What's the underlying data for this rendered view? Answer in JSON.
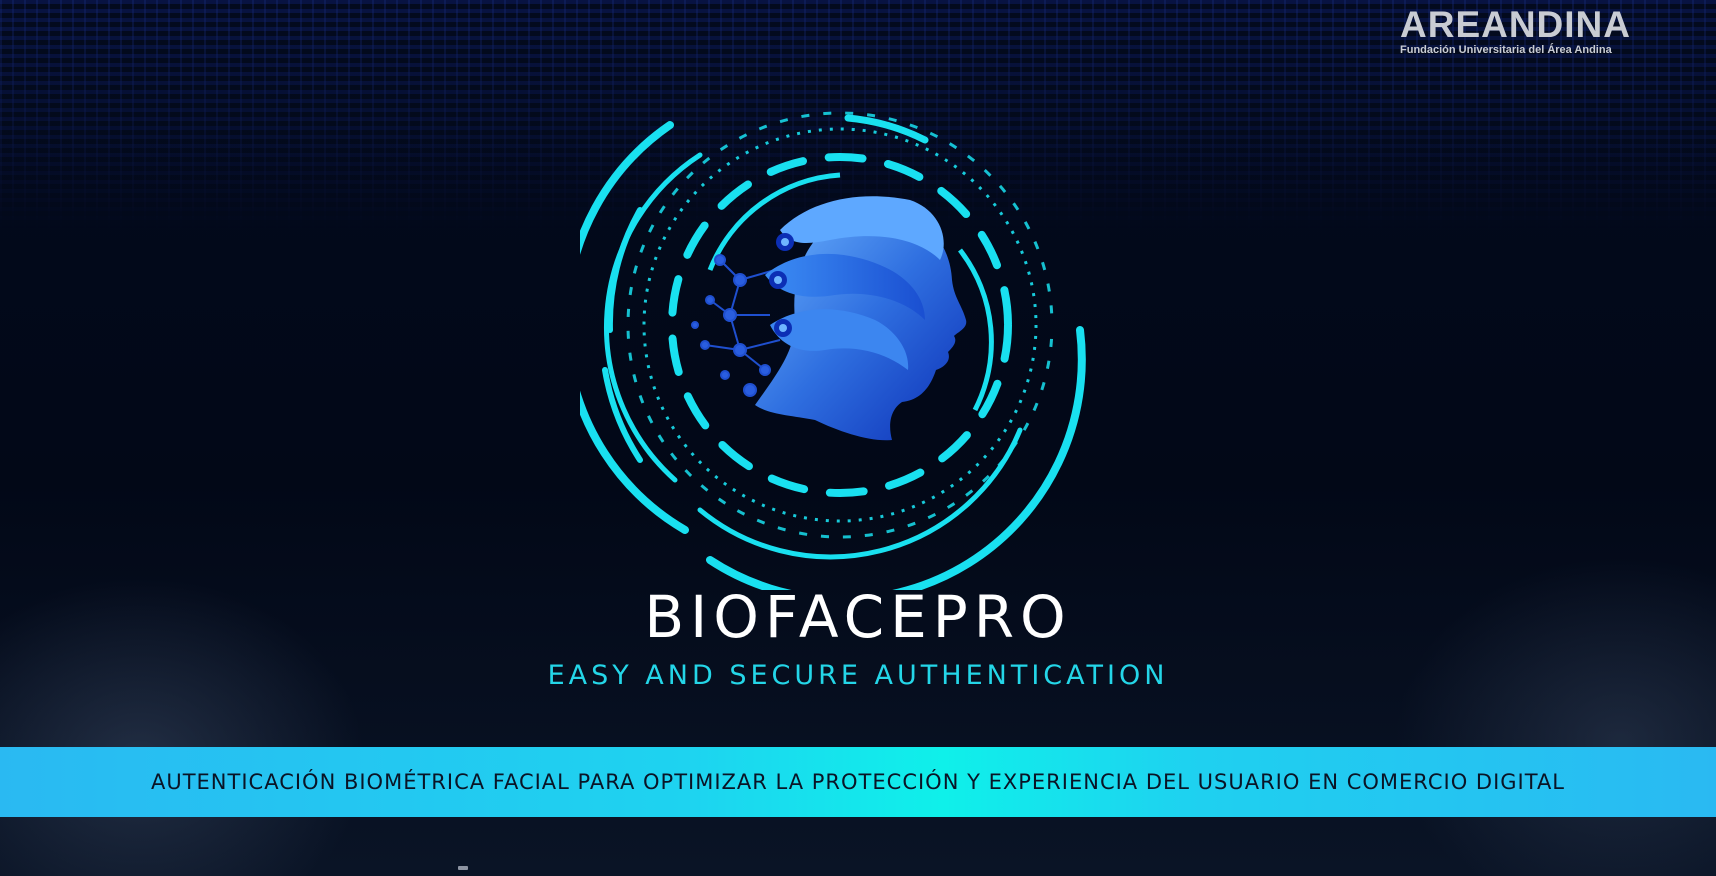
{
  "brand": {
    "name": "AREANDINA",
    "tagline": "Fundación Universitaria del Área Andina"
  },
  "hero": {
    "title": "BIOFACEPRO",
    "subtitle": "EASY AND SECURE AUTHENTICATION"
  },
  "banner": {
    "text": "AUTENTICACIÓN BIOMÉTRICA FACIAL PARA OPTIMIZAR LA PROTECCIÓN Y EXPERIENCIA DEL USUARIO EN COMERCIO DIGITAL"
  },
  "colors": {
    "background": "#030a1c",
    "accent_cyan": "#19e0f0",
    "subtitle_cyan": "#24d6e8",
    "banner_cyan": "#1ed3f0",
    "head_blue": "#2f6fe0"
  },
  "icons": {
    "emblem": "biometric-head-icon"
  }
}
